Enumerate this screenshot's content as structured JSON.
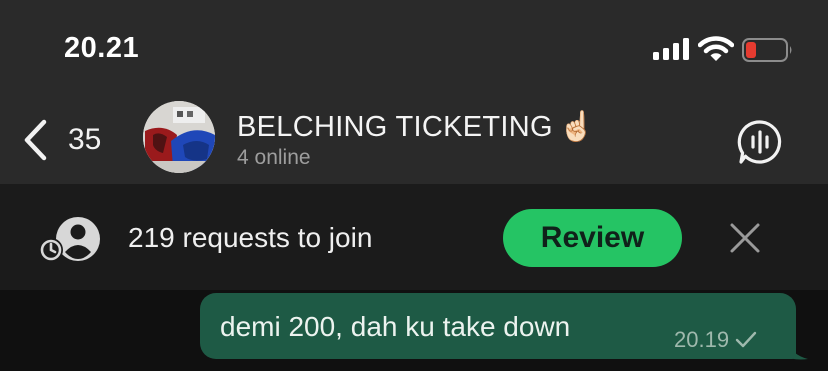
{
  "status_bar": {
    "time": "20.21",
    "icons": [
      "cellular-signal-icon",
      "wifi-icon",
      "battery-low-icon"
    ],
    "battery_color": "#e53b30"
  },
  "header": {
    "back_count": "35",
    "title": "BELCHING TICKETING",
    "title_emoji": "☝🏻",
    "subtitle": "4 online",
    "icons": [
      "back-chevron-icon",
      "group-avatar",
      "voice-chat-icon"
    ]
  },
  "banner": {
    "text": "219 requests to join",
    "review_label": "Review",
    "accent_color": "#25c464",
    "icons": [
      "pending-requests-icon",
      "close-icon"
    ]
  },
  "messages": [
    {
      "text": "demi 200, dah ku take down",
      "time": "20.19",
      "status_icon": "sent-check-icon",
      "bubble_color": "#1e5a45"
    }
  ]
}
